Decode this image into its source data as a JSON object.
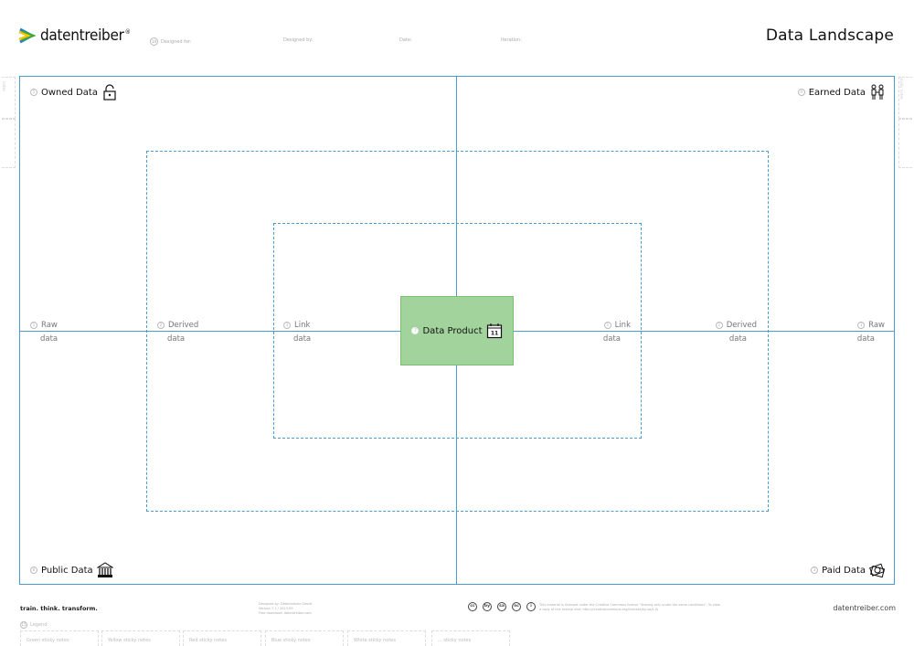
{
  "header": {
    "brand": "datentreiber",
    "brand_mark": "®",
    "meta_number": "14",
    "designed_for": "Designed for:",
    "designed_by": "Designed by:",
    "date": "Date:",
    "iteration": "Iteration:",
    "title": "Data Landscape"
  },
  "side": {
    "left_note": "notes",
    "right_note": "sticky notes"
  },
  "quadrants": {
    "owned": {
      "num": "5",
      "label": "Owned Data",
      "icon": "lock-icon"
    },
    "earned": {
      "num": "4",
      "label": "Earned Data",
      "icon": "people-icon"
    },
    "public": {
      "num": "6",
      "label": "Public Data",
      "icon": "bank-icon"
    },
    "paid": {
      "num": "3",
      "label": "Paid Data",
      "icon": "money-icon"
    }
  },
  "axis": {
    "left": [
      {
        "num": "1",
        "top": "Raw",
        "bottom": "data"
      },
      {
        "num": "2",
        "top": "Derived",
        "bottom": "data"
      },
      {
        "num": "3",
        "top": "Link",
        "bottom": "data"
      }
    ],
    "right": [
      {
        "num": "3",
        "top": "Link",
        "bottom": "data"
      },
      {
        "num": "2",
        "top": "Derived",
        "bottom": "data"
      },
      {
        "num": "1",
        "top": "Raw",
        "bottom": "data"
      }
    ]
  },
  "product": {
    "num": "7",
    "label": "Data Product",
    "icon": "calendar-icon",
    "icon_text": "11",
    "color": "#a3d39c"
  },
  "footer": {
    "tagline": "train. think. transform.",
    "credits": [
      "Designed by: Datentreiber GmbH",
      "Version 7.1 / 2023-09",
      "Free download: datentreiber.com"
    ],
    "cc_icons": [
      "cc",
      "by",
      "sa",
      "nc",
      "i"
    ],
    "license": "This material is licensed under the Creative Commons license \"Sharing only under the same conditions\". To view a copy of this license visit: http://creativecommons.org/licenses/by-sa/4.0/",
    "site": "datentreiber.com",
    "legend_num": "15",
    "legend_title": "Legend:",
    "legend": [
      "Green sticky notes",
      "Yellow sticky notes",
      "Red sticky notes",
      "Blue sticky notes",
      "White sticky notes",
      "... sticky notes"
    ]
  },
  "colors": {
    "accent": "#4a9bd2",
    "product": "#a3d39c"
  }
}
